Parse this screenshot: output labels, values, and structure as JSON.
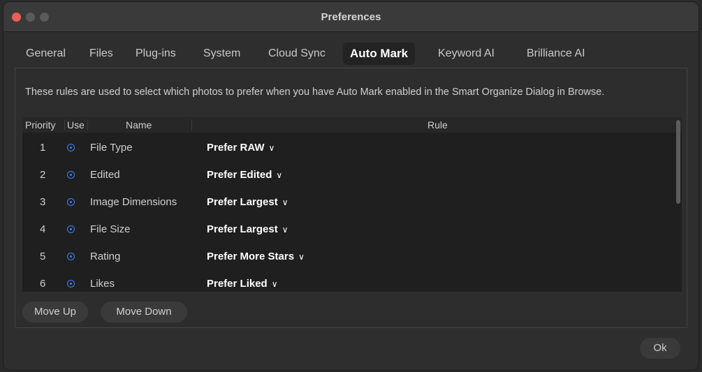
{
  "window": {
    "title": "Preferences"
  },
  "tabs": [
    {
      "label": "General"
    },
    {
      "label": "Files"
    },
    {
      "label": "Plug-ins"
    },
    {
      "label": "System"
    },
    {
      "label": "Cloud Sync"
    },
    {
      "label": "Auto Mark"
    },
    {
      "label": "Keyword AI"
    },
    {
      "label": "Brilliance AI"
    }
  ],
  "active_tab": "Auto Mark",
  "description": "These rules are used to select which photos to prefer when you have Auto Mark enabled in the Smart Organize Dialog in Browse.",
  "table": {
    "headers": {
      "priority": "Priority",
      "use": "Use",
      "name": "Name",
      "rule": "Rule"
    },
    "rows": [
      {
        "priority": "1",
        "use": true,
        "name": "File Type",
        "rule": "Prefer RAW"
      },
      {
        "priority": "2",
        "use": true,
        "name": "Edited",
        "rule": "Prefer Edited"
      },
      {
        "priority": "3",
        "use": true,
        "name": "Image Dimensions",
        "rule": "Prefer Largest"
      },
      {
        "priority": "4",
        "use": true,
        "name": "File Size",
        "rule": "Prefer Largest"
      },
      {
        "priority": "5",
        "use": true,
        "name": "Rating",
        "rule": "Prefer More Stars"
      },
      {
        "priority": "6",
        "use": true,
        "name": "Likes",
        "rule": "Prefer Liked"
      }
    ]
  },
  "buttons": {
    "move_up": "Move Up",
    "move_down": "Move Down",
    "ok": "Ok"
  },
  "icons": {
    "radio": "radio-selected-icon",
    "chevron": "chevron-down-icon"
  },
  "colors": {
    "accent": "#3b82f6",
    "close": "#ec5f57"
  }
}
